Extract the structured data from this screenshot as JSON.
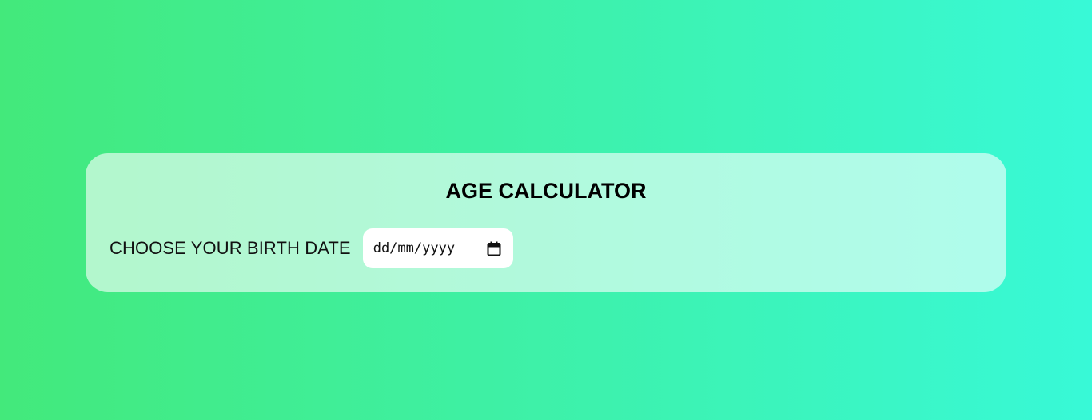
{
  "app": {
    "title": "AGE CALCULATOR"
  },
  "form": {
    "birth_date_label": "CHOOSE YOUR BIRTH DATE",
    "birth_date_placeholder": "dd/mm/yyyy",
    "birth_date_value": ""
  },
  "icons": {
    "calendar": "calendar-icon"
  },
  "colors": {
    "gradient_start": "#43e97b",
    "gradient_end": "#38f9d7",
    "card_background": "rgba(255,255,255,0.6)",
    "input_background": "#ffffff",
    "text": "#000000"
  }
}
